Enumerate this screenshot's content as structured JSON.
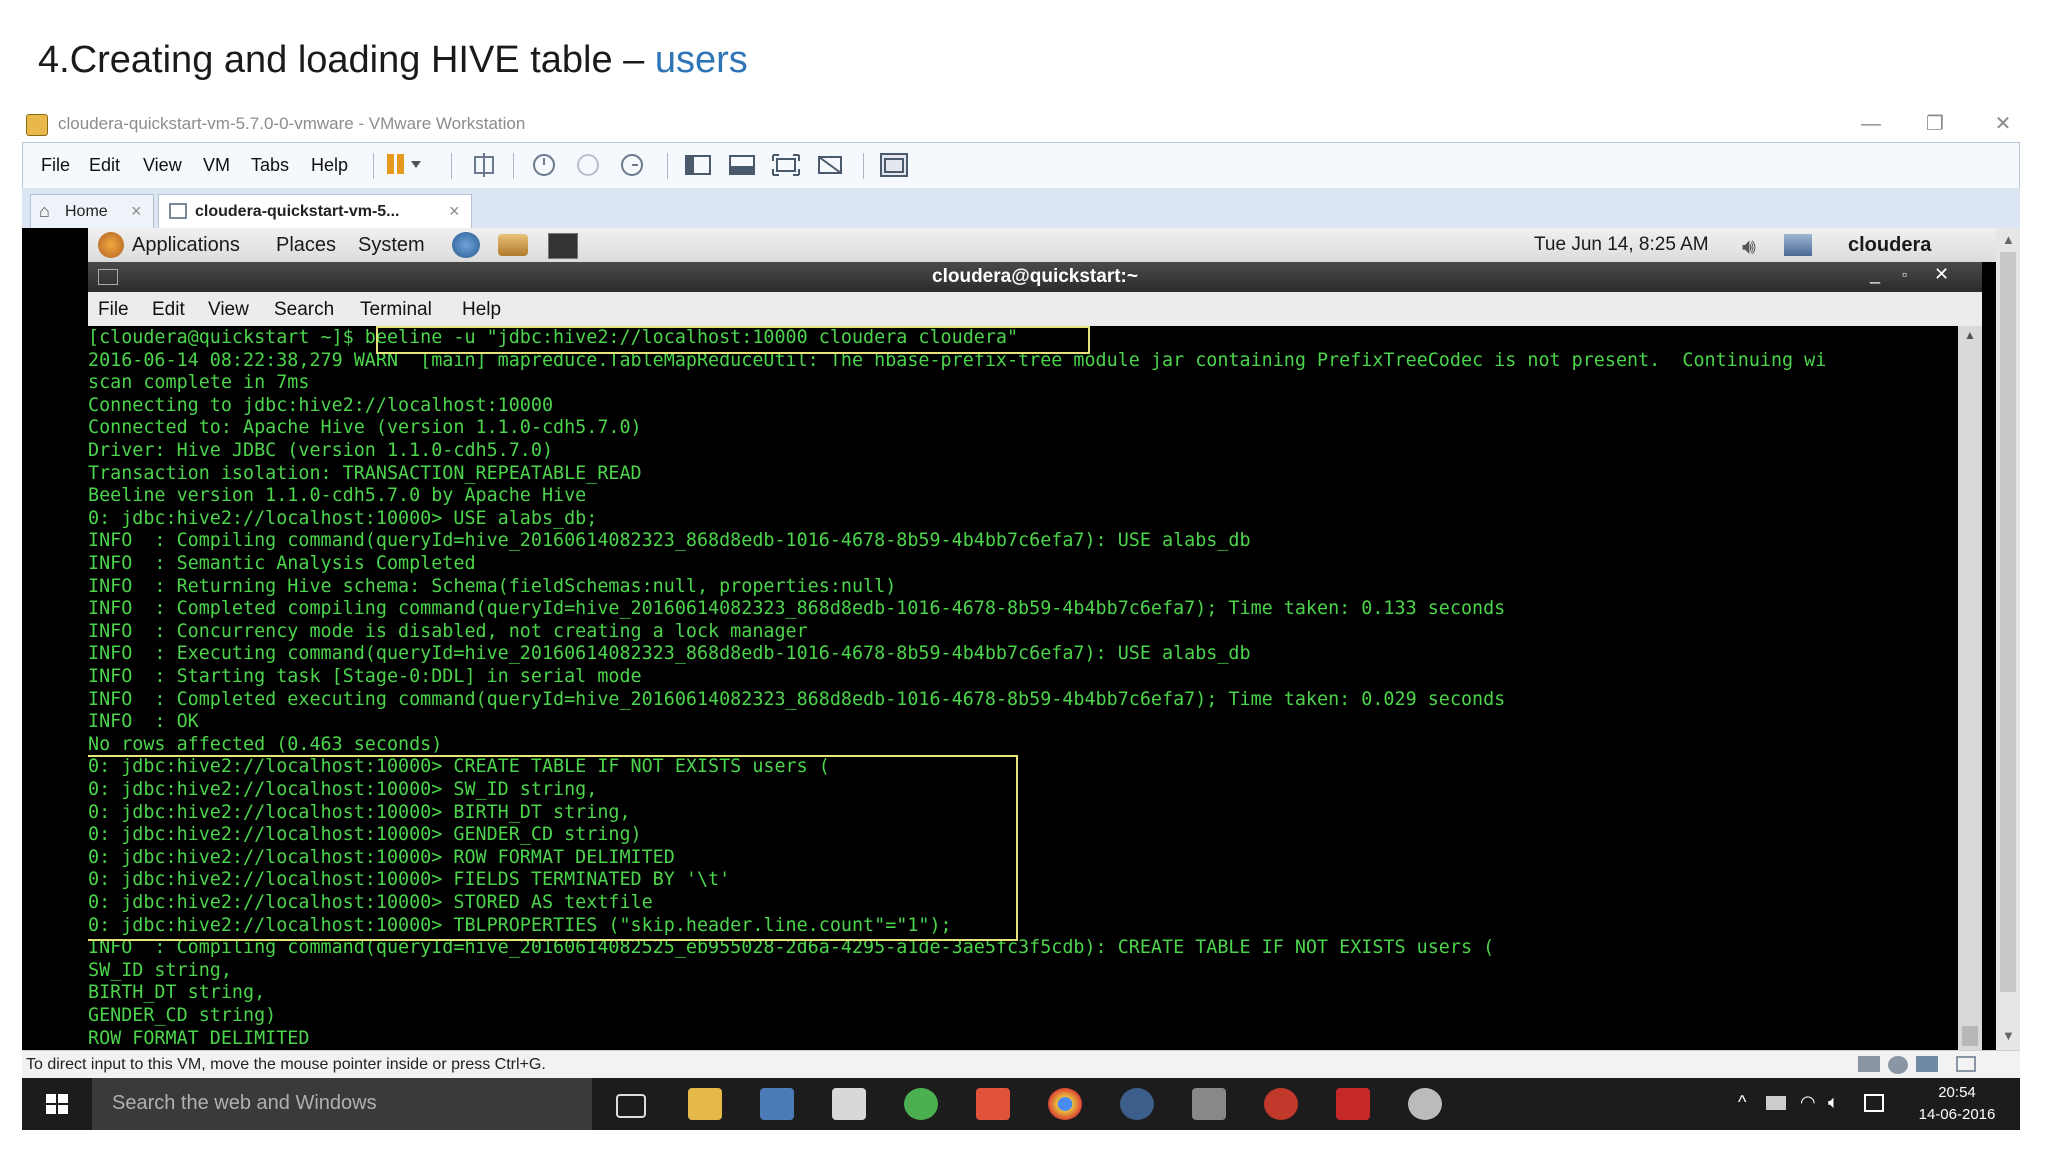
{
  "slide": {
    "title_prefix": "4.Creating and loading HIVE table – ",
    "title_accent": "users"
  },
  "vmware": {
    "title": "cloudera-quickstart-vm-5.7.0-0-vmware - VMware Workstation",
    "menu": [
      "File",
      "Edit",
      "View",
      "VM",
      "Tabs",
      "Help"
    ],
    "tabs": [
      {
        "label": "Home"
      },
      {
        "label": "cloudera-quickstart-vm-5..."
      }
    ],
    "status": "To direct input to this VM, move the mouse pointer inside or press Ctrl+G."
  },
  "gnome": {
    "menus": [
      "Applications",
      "Places",
      "System"
    ],
    "clock": "Tue Jun 14,  8:25 AM",
    "user": "cloudera"
  },
  "terminal": {
    "title": "cloudera@quickstart:~",
    "menu": [
      "File",
      "Edit",
      "View",
      "Search",
      "Terminal",
      "Help"
    ],
    "lines": [
      "[cloudera@quickstart ~]$ beeline -u \"jdbc:hive2://localhost:10000 cloudera cloudera\"",
      "2016-06-14 08:22:38,279 WARN  [main] mapreduce.TableMapReduceUtil: The hbase-prefix-tree module jar containing PrefixTreeCodec is not present.  Continuing wi",
      "scan complete in 7ms",
      "Connecting to jdbc:hive2://localhost:10000",
      "Connected to: Apache Hive (version 1.1.0-cdh5.7.0)",
      "Driver: Hive JDBC (version 1.1.0-cdh5.7.0)",
      "Transaction isolation: TRANSACTION_REPEATABLE_READ",
      "Beeline version 1.1.0-cdh5.7.0 by Apache Hive",
      "0: jdbc:hive2://localhost:10000> USE alabs_db;",
      "INFO  : Compiling command(queryId=hive_20160614082323_868d8edb-1016-4678-8b59-4b4bb7c6efa7): USE alabs_db",
      "INFO  : Semantic Analysis Completed",
      "INFO  : Returning Hive schema: Schema(fieldSchemas:null, properties:null)",
      "INFO  : Completed compiling command(queryId=hive_20160614082323_868d8edb-1016-4678-8b59-4b4bb7c6efa7); Time taken: 0.133 seconds",
      "INFO  : Concurrency mode is disabled, not creating a lock manager",
      "INFO  : Executing command(queryId=hive_20160614082323_868d8edb-1016-4678-8b59-4b4bb7c6efa7): USE alabs_db",
      "INFO  : Starting task [Stage-0:DDL] in serial mode",
      "INFO  : Completed executing command(queryId=hive_20160614082323_868d8edb-1016-4678-8b59-4b4bb7c6efa7); Time taken: 0.029 seconds",
      "INFO  : OK",
      "No rows affected (0.463 seconds)",
      "0: jdbc:hive2://localhost:10000> CREATE TABLE IF NOT EXISTS users (",
      "0: jdbc:hive2://localhost:10000> SW_ID string,",
      "0: jdbc:hive2://localhost:10000> BIRTH_DT string,",
      "0: jdbc:hive2://localhost:10000> GENDER_CD string)",
      "0: jdbc:hive2://localhost:10000> ROW FORMAT DELIMITED",
      "0: jdbc:hive2://localhost:10000> FIELDS TERMINATED BY '\\t'",
      "0: jdbc:hive2://localhost:10000> STORED AS textfile",
      "0: jdbc:hive2://localhost:10000> TBLPROPERTIES (\"skip.header.line.count\"=\"1\");",
      "INFO  : Compiling command(queryId=hive_20160614082525_eb955028-2d6a-4295-a1de-3ae5fc3f5cdb): CREATE TABLE IF NOT EXISTS users (",
      "SW_ID string,",
      "BIRTH_DT string,",
      "GENDER_CD string)",
      "ROW FORMAT DELIMITED"
    ]
  },
  "taskbar": {
    "search_placeholder": "Search the web and Windows",
    "time": "20:54",
    "date": "14-06-2016"
  }
}
